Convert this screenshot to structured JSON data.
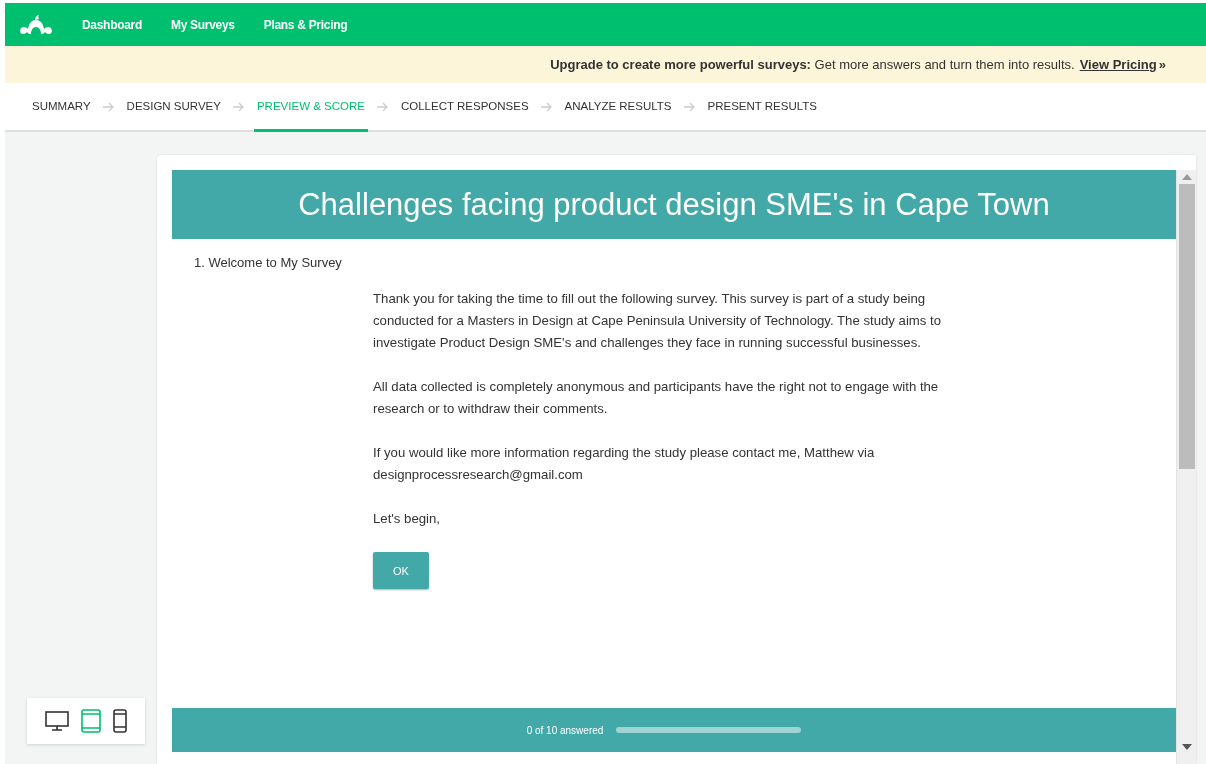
{
  "nav": {
    "links": [
      "Dashboard",
      "My Surveys",
      "Plans & Pricing"
    ]
  },
  "banner": {
    "text": "**Upgrade to create more powerful surveys:** Get more answers and turn them into results.",
    "link": "View Pricing",
    "link_suffix": "»"
  },
  "steps": [
    {
      "label": "SUMMARY",
      "selected": false
    },
    {
      "label": "DESIGN SURVEY",
      "selected": false
    },
    {
      "label": "PREVIEW & SCORE",
      "selected": true
    },
    {
      "label": "COLLECT RESPONSES",
      "selected": false
    },
    {
      "label": "ANALYZE RESULTS",
      "selected": false
    },
    {
      "label": "PRESENT RESULTS",
      "selected": false
    }
  ],
  "devices": [
    {
      "kind": "desktop",
      "selected": false
    },
    {
      "kind": "tablet",
      "selected": true
    },
    {
      "kind": "phone",
      "selected": false
    }
  ],
  "survey": {
    "title": "Challenges facing product design SME's in Cape Town",
    "question": "1. Welcome to My Survey",
    "paragraphs": [
      "Thank you for taking the time to fill out the following survey. This survey is part of a study being conducted for a Masters in Design at Cape Peninsula University of Technology. The study aims to investigate Product Design SME's and challenges they face in running successful businesses.",
      "All data collected is completely anonymous and participants have the right not to engage with the research or to withdraw their comments.",
      "If you would like more information regarding the study please contact me, Matthew via designprocessresearch@gmail.com",
      "Let's begin,"
    ],
    "button": "OK",
    "progress": {
      "text": "0 of 10 answered",
      "level": 0
    }
  }
}
